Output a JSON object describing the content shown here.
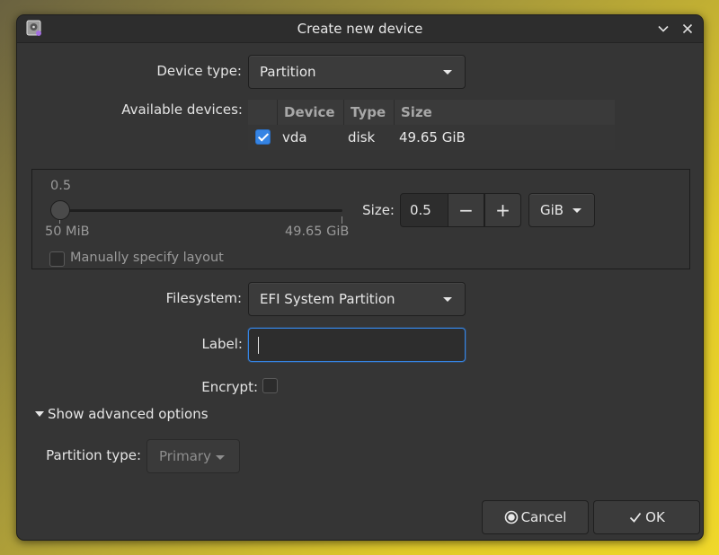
{
  "window": {
    "title": "Create new device",
    "controls": {
      "minimize_icon": "chevron-down-icon",
      "close_icon": "close-icon"
    }
  },
  "device_type": {
    "label": "Device type:",
    "value": "Partition"
  },
  "available_devices": {
    "label": "Available devices:",
    "columns": [
      "Device",
      "Type",
      "Size"
    ],
    "rows": [
      {
        "checked": true,
        "device": "vda",
        "type": "disk",
        "size": "49.65 GiB"
      }
    ]
  },
  "size": {
    "current_value_label": "0.5",
    "min_label": "50 MiB",
    "max_label": "49.65 GiB",
    "size_label": "Size:",
    "spin_value": "0.5",
    "minus": "−",
    "plus": "+",
    "unit": "GiB",
    "manual_layout_label": "Manually specify layout",
    "manual_layout_checked": false
  },
  "filesystem": {
    "label": "Filesystem:",
    "value": "EFI System Partition"
  },
  "label_field": {
    "label": "Label:",
    "value": ""
  },
  "encrypt": {
    "label": "Encrypt:",
    "checked": false
  },
  "advanced": {
    "toggle_label": "Show advanced options"
  },
  "partition_type": {
    "label": "Partition type:",
    "value": "Primary"
  },
  "actions": {
    "cancel": "Cancel",
    "ok": "OK"
  },
  "colors": {
    "accent": "#3584e4",
    "window_bg": "#353535",
    "titlebar_bg": "#2d2d2d"
  }
}
